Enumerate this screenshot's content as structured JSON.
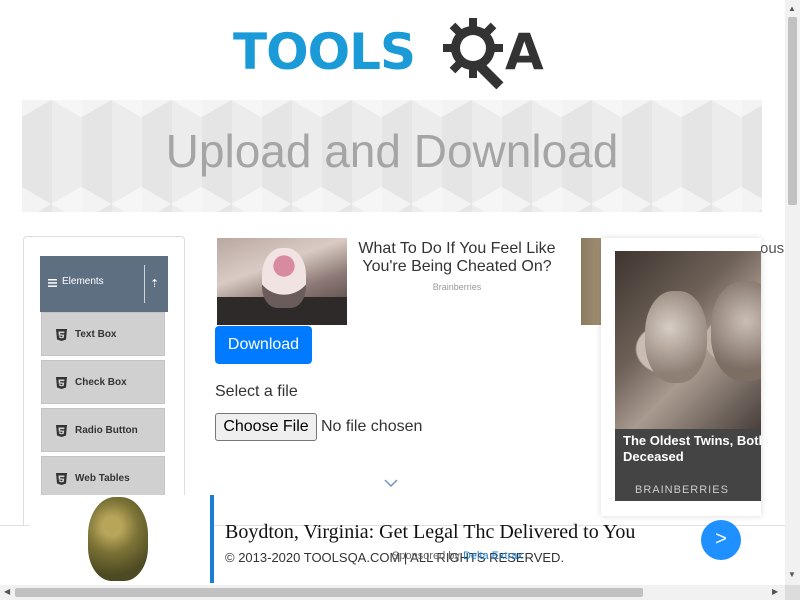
{
  "logo": {
    "word_tools": "TOOLS",
    "word_qa": "A"
  },
  "banner": {
    "title": "Upload and Download"
  },
  "sidebar": {
    "group": {
      "label": "Elements",
      "icon": "menu-icon",
      "toggle_icon": "collapse-arrow-icon"
    },
    "items": [
      {
        "label": "Text Box",
        "icon": "html5-icon"
      },
      {
        "label": "Check Box",
        "icon": "html5-icon"
      },
      {
        "label": "Radio Button",
        "icon": "html5-icon"
      },
      {
        "label": "Web Tables",
        "icon": "html5-icon"
      }
    ]
  },
  "ad_strip": {
    "title": "What To Do If You Feel Like You're Being Cheated On?",
    "source": "Brainberries",
    "next_fragment": "ous"
  },
  "main": {
    "download_label": "Download",
    "select_label": "Select a file",
    "choose_label": "Choose File",
    "no_file_label": "No file chosen"
  },
  "float_ad": {
    "title": "The Oldest Twins, Both Deceased",
    "source": "BRAINBERRIES"
  },
  "footer": {
    "text": "© 2013-2020 TOOLSQA.COM | ALL RIGHTS RESERVED."
  },
  "bottom_ad": {
    "title": "Boydton, Virginia: Get Legal Thc Delivered to You",
    "sponsored_prefix": "Sponsored by ",
    "sponsored_brand": "Delta Extrax",
    "go_label": ">"
  },
  "colors": {
    "accent": "#007bff",
    "logo_blue": "#1a9ad6",
    "sidebar_header": "#5f6f82"
  }
}
